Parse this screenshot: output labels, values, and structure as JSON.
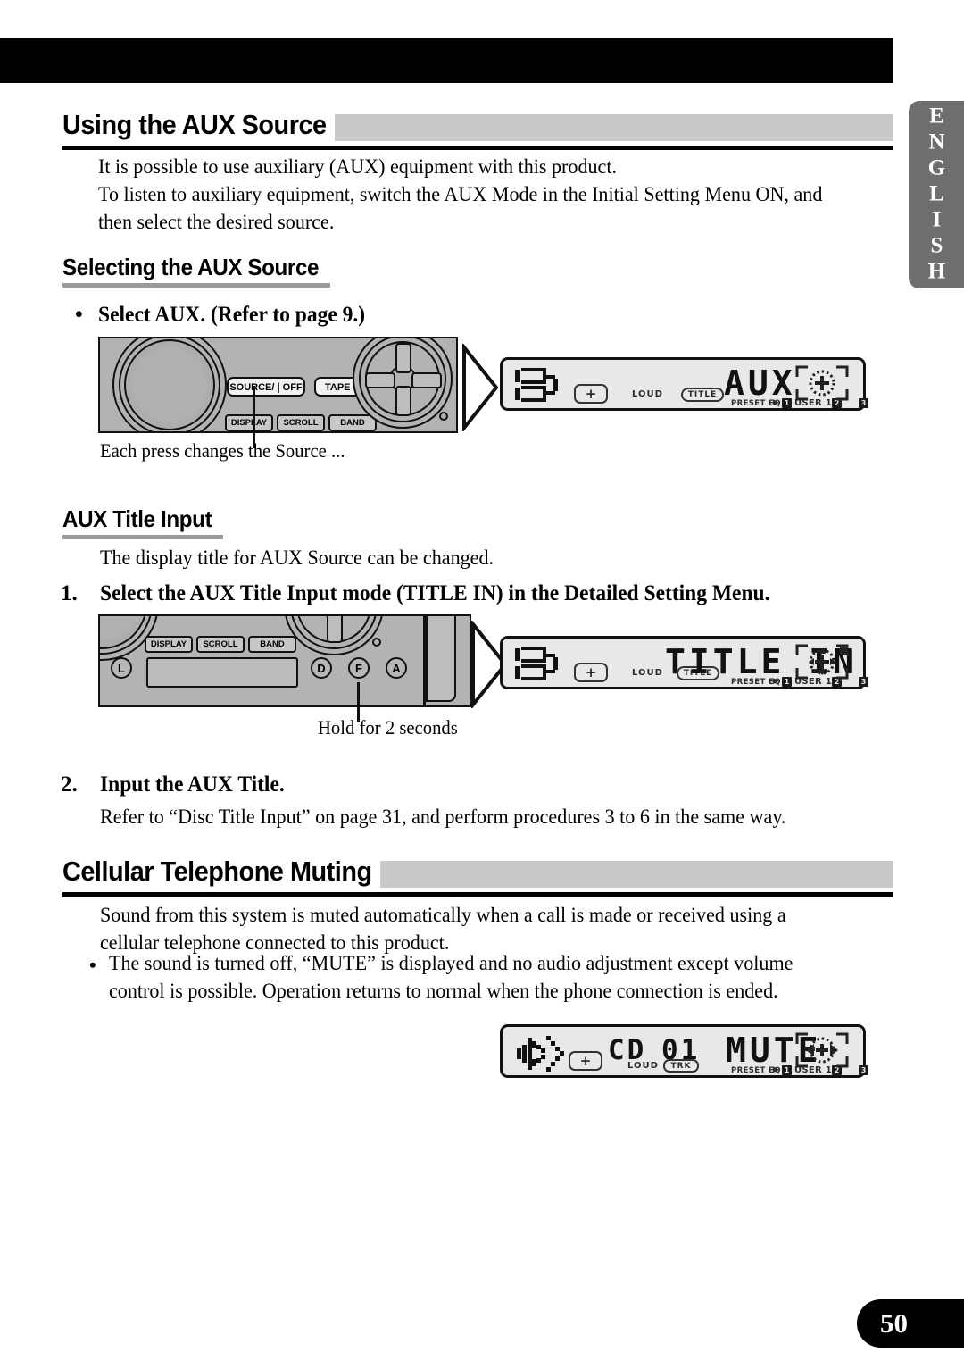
{
  "document": {
    "page_number": "50",
    "language_tab": "ENGLISH"
  },
  "sections": [
    {
      "heading": "Using the AUX Source",
      "paragraphs": [
        "It is possible to use auxiliary (AUX) equipment with this product.",
        "To listen to auxiliary equipment, switch the AUX Mode in the Initial Setting Menu ON, and then select the desired source."
      ]
    }
  ],
  "selecting_aux": {
    "heading": "Selecting the AUX Source",
    "bullet": "Select AUX. (Refer to page 9.)",
    "caption": "Each press changes the Source ..."
  },
  "aux_title_input": {
    "heading": "AUX Title Input",
    "intro": "The display title for AUX Source can be changed.",
    "step1_num": "1.",
    "step1_text": "Select the AUX Title Input mode (TITLE IN) in the Detailed Setting Menu.",
    "caption": "Hold for 2 seconds",
    "step2_num": "2.",
    "step2_text": "Input the AUX Title.",
    "step2_body": "Refer to “Disc Title Input” on page 31, and perform procedures 3 to 6 in the same way."
  },
  "cellular": {
    "heading": "Cellular Telephone Muting",
    "paragraph": "Sound from this system is muted automatically when a call is made or received using a cellular telephone connected to this product.",
    "bullet": "The sound is turned off, “MUTE” is displayed and no audio adjustment except volume control is possible. Operation returns to normal when the phone connection is ended."
  },
  "device_panel_1": {
    "buttons": {
      "source_off": "SOURCE/❘OFF",
      "tape_eject": "TAPE ⏏",
      "display": "DISPLAY",
      "scroll": "SCROLL",
      "band": "BAND"
    }
  },
  "device_panel_2": {
    "buttons": {
      "display": "DISPLAY",
      "scroll": "SCROLL",
      "band": "BAND"
    },
    "circle_labels": [
      "L",
      "D",
      "F",
      "A"
    ]
  },
  "lcd_aux": {
    "main": "AUX",
    "loud": "LOUD",
    "title": "TITLE",
    "preset_eq": "PRESET EQ",
    "eq_arrow": "▶",
    "chip1": "1",
    "user": "USER 1",
    "chip2": "2",
    "chip3": "3"
  },
  "lcd_title_in": {
    "main": "TITLE IN",
    "loud": "LOUD",
    "title": "TITLE",
    "preset_eq": "PRESET EQ",
    "eq_arrow": "▶",
    "chip1": "1",
    "user": "USER 1",
    "chip2": "2",
    "chip3": "3"
  },
  "lcd_mute": {
    "source": "CD",
    "track": "01",
    "main": "MUTE",
    "loud": "LOUD",
    "trk": "TRK",
    "preset_eq": "PRESET EQ",
    "eq_arrow": "▶",
    "chip1": "1",
    "user": "USER 1",
    "chip2": "2",
    "chip3": "3"
  },
  "colors": {
    "bar_gray": "#c9c9c9",
    "rule_black": "#000000",
    "sub_rule_gray": "#9a9a9a",
    "tab_gray": "#6e6e6e",
    "device_gray": "#b3b3b3",
    "lcd_bg": "#e8e8e8"
  }
}
